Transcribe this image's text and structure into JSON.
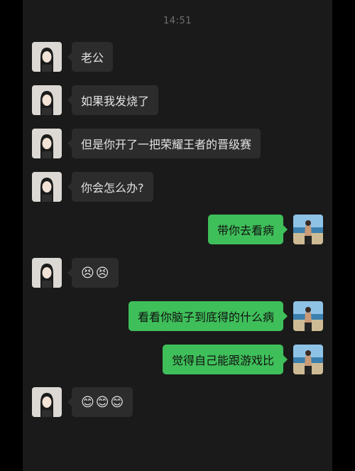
{
  "status": {
    "time": "14:51"
  },
  "messages": [
    {
      "side": "left",
      "text": "老公"
    },
    {
      "side": "left",
      "text": "如果我发烧了"
    },
    {
      "side": "left",
      "text": "但是你开了一把荣耀王者的晋级赛"
    },
    {
      "side": "left",
      "text": "你会怎么办?"
    },
    {
      "side": "right",
      "text": "带你去看病"
    },
    {
      "side": "left",
      "emojis": [
        "😣",
        "😣"
      ]
    },
    {
      "side": "right",
      "text": "看看你脑子到底得的什么病"
    },
    {
      "side": "right",
      "text": "觉得自己能跟游戏比"
    },
    {
      "side": "left",
      "emojis": [
        "😊",
        "😊",
        "😊"
      ]
    }
  ],
  "colors": {
    "background": "#1a1a1a",
    "incoming_bubble": "#2c2c2c",
    "outgoing_bubble": "#3fbf5a"
  }
}
